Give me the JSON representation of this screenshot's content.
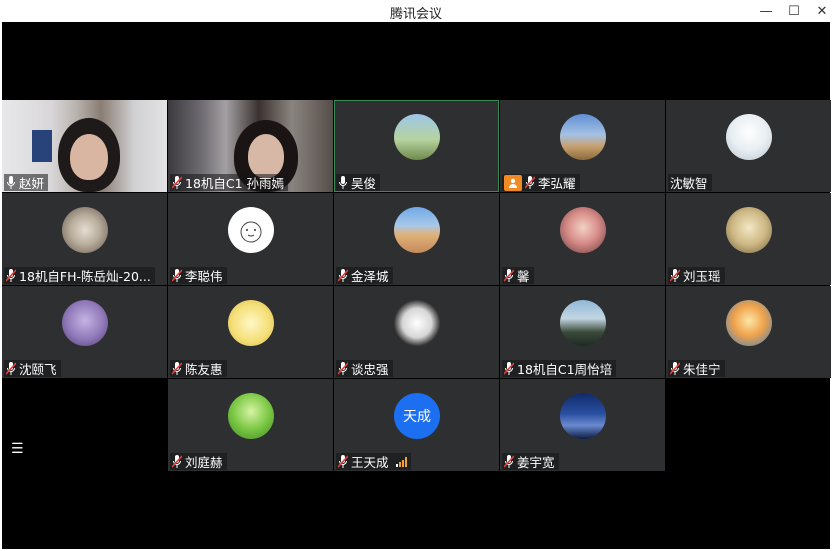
{
  "window": {
    "title": "腾讯会议",
    "minimize_icon": "—",
    "maximize_icon": "☐",
    "close_icon": "✕"
  },
  "participants": [
    {
      "name": "赵妍",
      "type": "video",
      "mic": "on"
    },
    {
      "name": "18机自C1 孙雨嫣",
      "type": "video",
      "mic": "muted"
    },
    {
      "name": "吴俊",
      "type": "avatar",
      "mic": "on",
      "active": true
    },
    {
      "name": "李弘耀",
      "type": "avatar",
      "mic": "muted",
      "sharing": true
    },
    {
      "name": "沈敏智",
      "type": "avatar",
      "mic": "none"
    },
    {
      "name": "18机自FH-陈岳灿-20...",
      "type": "avatar",
      "mic": "muted"
    },
    {
      "name": "李聪伟",
      "type": "avatar",
      "mic": "muted"
    },
    {
      "name": "金泽城",
      "type": "avatar",
      "mic": "muted"
    },
    {
      "name": "馨",
      "type": "avatar",
      "mic": "muted"
    },
    {
      "name": "刘玉瑶",
      "type": "avatar",
      "mic": "muted"
    },
    {
      "name": "沈颐飞",
      "type": "avatar",
      "mic": "muted"
    },
    {
      "name": "陈友惠",
      "type": "avatar",
      "mic": "muted"
    },
    {
      "name": "谈忠强",
      "type": "avatar",
      "mic": "muted"
    },
    {
      "name": "18机自C1周怡培",
      "type": "avatar",
      "mic": "muted"
    },
    {
      "name": "朱佳宁",
      "type": "avatar",
      "mic": "muted"
    },
    {
      "name": "刘庭赫",
      "type": "avatar",
      "mic": "muted"
    },
    {
      "name": "王天成",
      "type": "avatar",
      "mic": "muted",
      "avatar_text": "天成",
      "signal": true
    },
    {
      "name": "姜宇宽",
      "type": "avatar",
      "mic": "muted"
    }
  ],
  "menu_icon": "☰",
  "colors": {
    "stage": "#000000",
    "tile": "#2e2f31",
    "active_border": "#3a8a56",
    "share_badge": "#f08a24",
    "wang_avatar": "#1d6ff2"
  }
}
